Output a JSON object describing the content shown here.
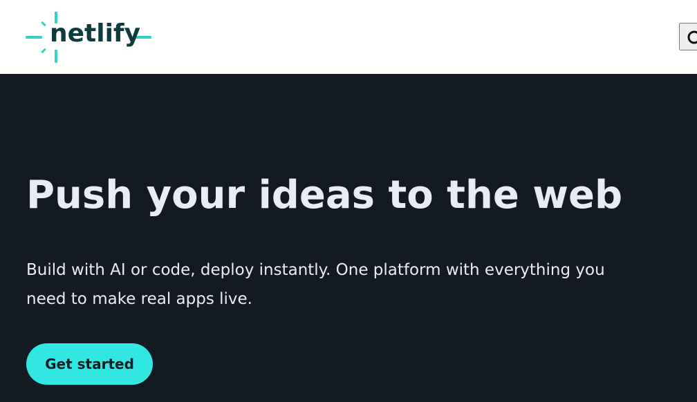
{
  "header": {
    "logo": {
      "text": "netlify",
      "icon": "netlify-logo-mark-icon",
      "text_color": "#0f3b3f",
      "accent_color": "#32d2c4"
    },
    "search": {
      "icon": "search-icon"
    }
  },
  "hero": {
    "background": "#141a21",
    "title": "Push your ideas to the web",
    "subtitle": "Build with AI or code, deploy instantly. One platform with everything you need to make real apps live.",
    "cta": {
      "label": "Get started",
      "background": "#32e6e2",
      "text_color": "#0f1a1f"
    }
  }
}
